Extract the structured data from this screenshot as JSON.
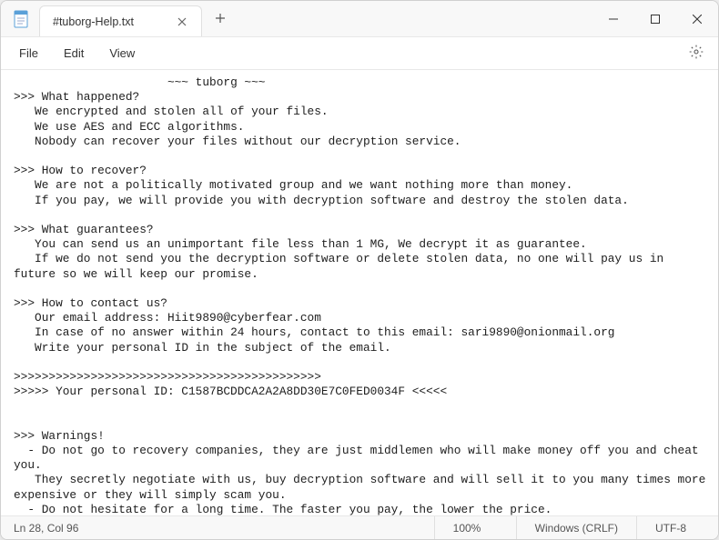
{
  "titlebar": {
    "tab_title": "#tuborg-Help.txt"
  },
  "menubar": {
    "file": "File",
    "edit": "Edit",
    "view": "View"
  },
  "content": {
    "text": "                      ~~~ tuborg ~~~\n>>> What happened?\n   We encrypted and stolen all of your files.\n   We use AES and ECC algorithms.\n   Nobody can recover your files without our decryption service.\n\n>>> How to recover?\n   We are not a politically motivated group and we want nothing more than money.\n   If you pay, we will provide you with decryption software and destroy the stolen data.\n\n>>> What guarantees?\n   You can send us an unimportant file less than 1 MG, We decrypt it as guarantee.\n   If we do not send you the decryption software or delete stolen data, no one will pay us in future so we will keep our promise.\n\n>>> How to contact us?\n   Our email address: Hiit9890@cyberfear.com\n   In case of no answer within 24 hours, contact to this email: sari9890@onionmail.org\n   Write your personal ID in the subject of the email.\n\n>>>>>>>>>>>>>>>>>>>>>>>>>>>>>>>>>>>>>>>>>>>>\n>>>>> Your personal ID: C1587BCDDCA2A2A8DD30E7C0FED0034F <<<<<\n\n\n>>> Warnings!\n  - Do not go to recovery companies, they are just middlemen who will make money off you and cheat you.\n   They secretly negotiate with us, buy decryption software and will sell it to you many times more expensive or they will simply scam you.\n  - Do not hesitate for a long time. The faster you pay, the lower the price.\n  - Do not delete or modify encrypted files, it will lead to problems with decryption of files."
  },
  "statusbar": {
    "position": "Ln 28, Col 96",
    "zoom": "100%",
    "line_ending": "Windows (CRLF)",
    "encoding": "UTF-8"
  }
}
